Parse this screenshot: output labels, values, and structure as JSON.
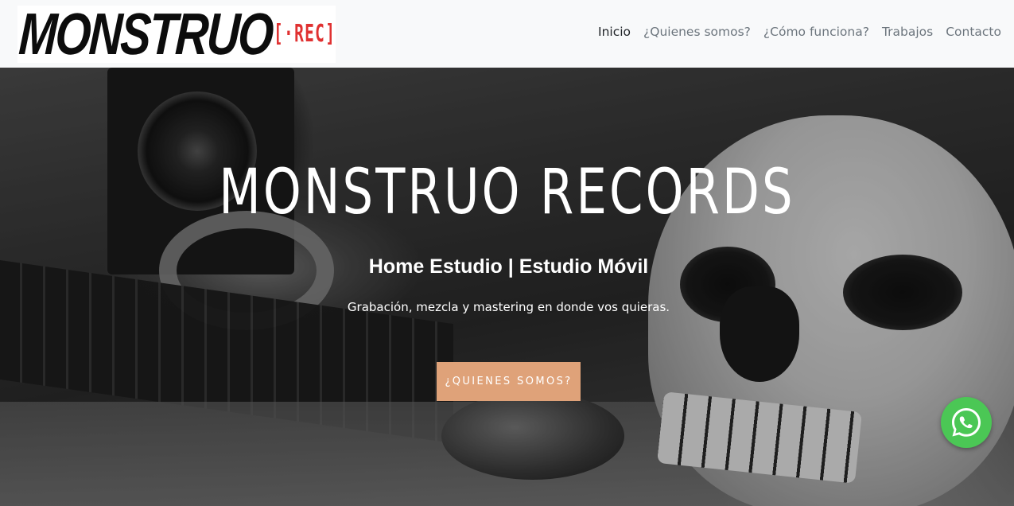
{
  "brand": {
    "logo_main": "MONSTRUO",
    "logo_sub": "[·REC]",
    "logo_sub_color": "#e03131"
  },
  "nav": {
    "items": [
      {
        "label": "Inicio",
        "active": true
      },
      {
        "label": "¿Quienes somos?",
        "active": false
      },
      {
        "label": "¿Cómo funciona?",
        "active": false
      },
      {
        "label": "Trabajos",
        "active": false
      },
      {
        "label": "Contacto",
        "active": false
      }
    ]
  },
  "hero": {
    "title": "MONSTRUO RECORDS",
    "subtitle": "Home Estudio | Estudio Móvil",
    "text": "Grabación, mezcla y mastering en donde vos quieras.",
    "cta_label": "¿QUIENES SOMOS?",
    "cta_color": "#dfa279"
  },
  "floating": {
    "icon": "whatsapp-icon",
    "color": "#4bc755"
  }
}
